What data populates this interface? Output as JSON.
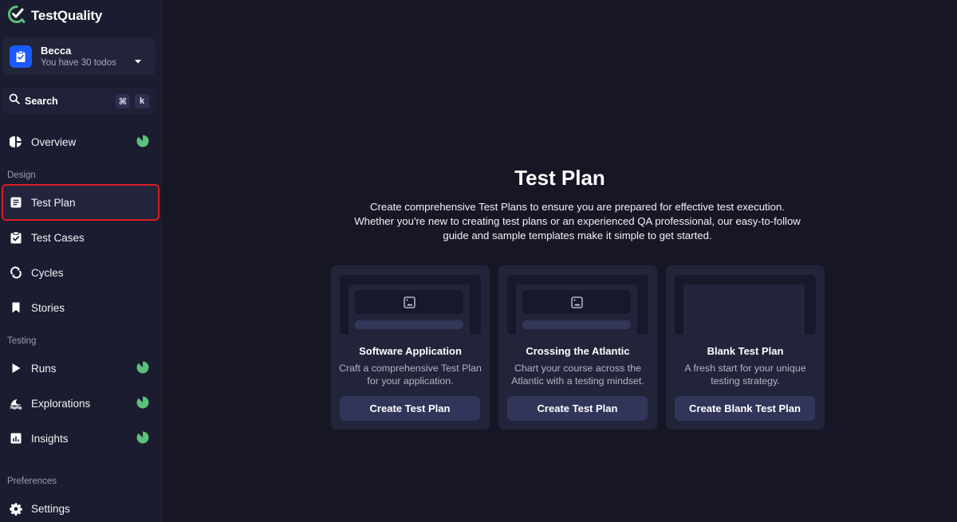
{
  "app": {
    "name": "TestQuality",
    "brand_color": "#5cbf7c"
  },
  "user": {
    "name": "Becca",
    "subtitle": "You have 30 todos",
    "avatar_color": "#1a5bff"
  },
  "search": {
    "label": "Search",
    "shortcut_keys": [
      "⌘",
      "k"
    ]
  },
  "sidebar": {
    "overview": {
      "label": "Overview",
      "icon": "pie-chart-icon",
      "has_progress": true
    },
    "sections": [
      {
        "label": "Design",
        "items": [
          {
            "label": "Test Plan",
            "icon": "document-icon",
            "active": true
          },
          {
            "label": "Test Cases",
            "icon": "clipboard-check-icon"
          },
          {
            "label": "Cycles",
            "icon": "cycle-arrows-icon"
          },
          {
            "label": "Stories",
            "icon": "bookmark-icon"
          }
        ]
      },
      {
        "label": "Testing",
        "items": [
          {
            "label": "Runs",
            "icon": "play-icon",
            "has_progress": true
          },
          {
            "label": "Explorations",
            "icon": "wave-icon",
            "has_progress": true
          },
          {
            "label": "Insights",
            "icon": "bar-chart-icon",
            "has_progress": true
          }
        ]
      },
      {
        "label": "Preferences",
        "items": [
          {
            "label": "Settings",
            "icon": "gear-icon"
          }
        ]
      }
    ],
    "progress_color": "#5cbf7c",
    "active_highlight_color": "#d91d25"
  },
  "main": {
    "title": "Test Plan",
    "description": "Create comprehensive Test Plans to ensure you are prepared for effective test execution. Whether you're new to creating test plans or an experienced QA professional, our easy-to-follow guide and sample templates make it simple to get started.",
    "cards": [
      {
        "title": "Software Application",
        "description": "Craft a comprehensive Test Plan for your application.",
        "button": "Create Test Plan",
        "preview": "image-placeholder"
      },
      {
        "title": "Crossing the Atlantic",
        "description": "Chart your course across the Atlantic with a testing mindset.",
        "button": "Create Test Plan",
        "preview": "image-placeholder"
      },
      {
        "title": "Blank Test Plan",
        "description": "A fresh start for your unique testing strategy.",
        "button": "Create Blank Test Plan",
        "preview": "blank"
      }
    ]
  }
}
